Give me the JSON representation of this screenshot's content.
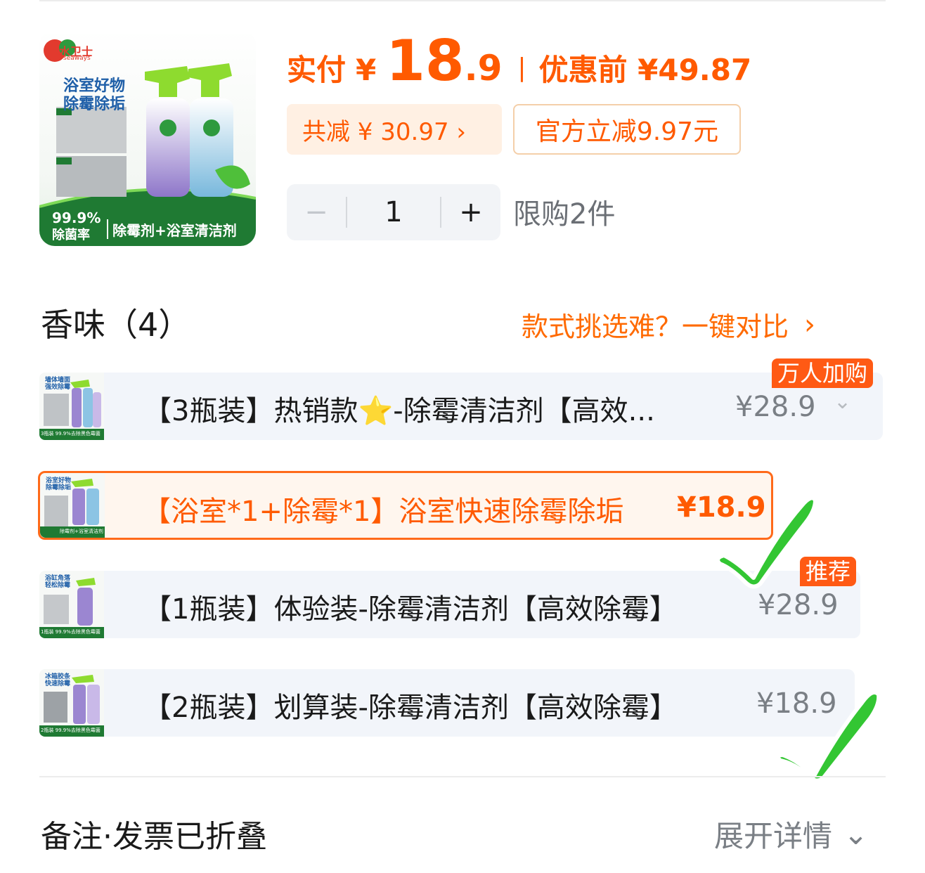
{
  "product": {
    "image_brand": "水卫士",
    "image_brand_en": "seaways",
    "image_headline_1": "浴室好物",
    "image_headline_2": "除霉除垢",
    "image_footer_stat": "99.9%",
    "image_footer_stat_label": "除菌率",
    "image_footer_text": "除霉剂+浴室清洁剂"
  },
  "price": {
    "label": "实付",
    "yen": "¥",
    "integer": "18",
    "decimal": ".9",
    "separator": "|",
    "before_label": "优惠前 ¥49.87"
  },
  "tags": {
    "discount": "共减 ¥ 30.97 ›",
    "official": "官方立减9.97元"
  },
  "quantity": {
    "minus": "−",
    "value": "1",
    "plus": "+",
    "limit": "限购2件"
  },
  "section": {
    "title": "香味（4）",
    "compare_link": "款式挑选难？一键对比",
    "compare_arrow": "›"
  },
  "options": [
    {
      "label": "【3瓶装】热销款⭐-除霉清洁剂【高效...",
      "price": "¥28.9",
      "badge": "万人加购",
      "chevron": "⌄",
      "thumb_text": "墙体墙面 强效除霉",
      "thumb_footer": "3瓶装 99.9%去除黑色霉菌",
      "selected": false
    },
    {
      "label": "【浴室*1+除霉*1】浴室快速除霉除垢",
      "price": "¥18.9",
      "thumb_text": "浴室好物 除霉除垢",
      "thumb_footer": "除霉剂+浴室清洁剂",
      "selected": true
    },
    {
      "label": "【1瓶装】体验装-除霉清洁剂【高效除霉】",
      "price": "¥28.9",
      "badge": "推荐",
      "thumb_text": "浴缸角落 轻松除霉",
      "thumb_footer": "1瓶装 99.9%去除黑色霉菌",
      "selected": false
    },
    {
      "label": "【2瓶装】划算装-除霉清洁剂【高效除霉】",
      "price": "¥18.9",
      "thumb_text": "冰箱胶条 快速除霉",
      "thumb_footer": "2瓶装 99.9%去除黑色霉菌",
      "selected": false
    }
  ],
  "footer": {
    "notes_label": "备注·发票已折叠",
    "expand_label": "展开详情",
    "expand_chevron": "⌄"
  },
  "colors": {
    "accent": "#ff5a00",
    "check_green": "#33c633"
  }
}
